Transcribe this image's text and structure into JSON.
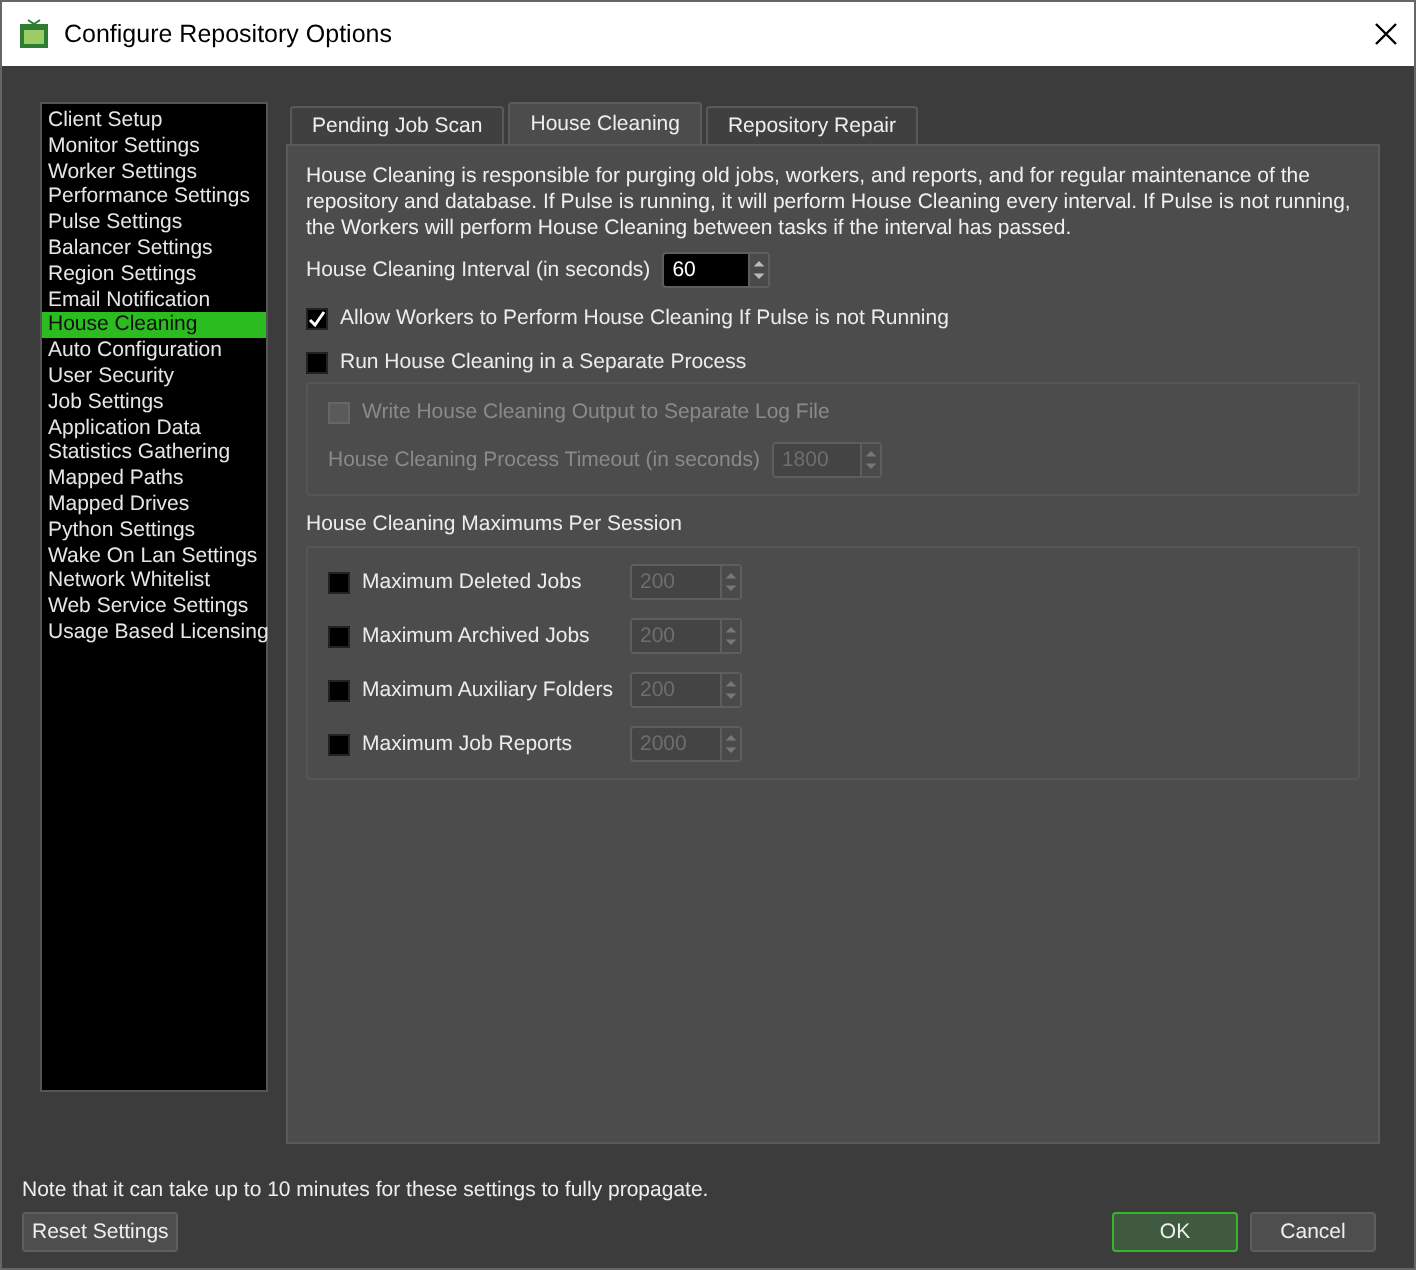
{
  "window": {
    "title": "Configure Repository Options"
  },
  "sidebar": {
    "items": [
      {
        "label": "Client Setup",
        "selected": false
      },
      {
        "label": "Monitor Settings",
        "selected": false
      },
      {
        "label": "Worker Settings",
        "selected": false
      },
      {
        "label": "Performance Settings",
        "selected": false
      },
      {
        "label": "Pulse Settings",
        "selected": false
      },
      {
        "label": "Balancer Settings",
        "selected": false
      },
      {
        "label": "Region Settings",
        "selected": false
      },
      {
        "label": "Email Notification",
        "selected": false
      },
      {
        "label": "House Cleaning",
        "selected": true
      },
      {
        "label": "Auto Configuration",
        "selected": false
      },
      {
        "label": "User Security",
        "selected": false
      },
      {
        "label": "Job Settings",
        "selected": false
      },
      {
        "label": "Application Data",
        "selected": false
      },
      {
        "label": "Statistics Gathering",
        "selected": false
      },
      {
        "label": "Mapped Paths",
        "selected": false
      },
      {
        "label": "Mapped Drives",
        "selected": false
      },
      {
        "label": "Python Settings",
        "selected": false
      },
      {
        "label": "Wake On Lan Settings",
        "selected": false
      },
      {
        "label": "Network Whitelist",
        "selected": false
      },
      {
        "label": "Web Service Settings",
        "selected": false
      },
      {
        "label": "Usage Based Licensing",
        "selected": false
      }
    ]
  },
  "tabs": [
    {
      "label": "Pending Job Scan",
      "selected": false
    },
    {
      "label": "House Cleaning",
      "selected": true
    },
    {
      "label": "Repository Repair",
      "selected": false
    }
  ],
  "description": "House Cleaning is responsible for purging old jobs, workers, and reports, and for regular maintenance of the repository and database. If Pulse is running, it will perform House Cleaning every interval. If Pulse is not running, the Workers will perform House Cleaning between tasks if the interval has passed.",
  "interval": {
    "label": "House Cleaning Interval (in seconds)",
    "value": "60"
  },
  "allow_workers": {
    "label": "Allow Workers to Perform House Cleaning If Pulse is not Running",
    "checked": true
  },
  "separate_process": {
    "label": "Run House Cleaning in a Separate Process",
    "checked": false
  },
  "process_group": {
    "disabled": true,
    "log_file": {
      "label": "Write House Cleaning Output to Separate Log File",
      "checked": false
    },
    "timeout": {
      "label": "House Cleaning Process Timeout (in seconds)",
      "value": "1800"
    }
  },
  "maximums": {
    "title": "House Cleaning Maximums Per Session",
    "rows": [
      {
        "label": "Maximum Deleted Jobs",
        "checked": false,
        "value": "200"
      },
      {
        "label": "Maximum Archived Jobs",
        "checked": false,
        "value": "200"
      },
      {
        "label": "Maximum Auxiliary Folders",
        "checked": false,
        "value": "200"
      },
      {
        "label": "Maximum Job Reports",
        "checked": false,
        "value": "2000"
      }
    ]
  },
  "footer": {
    "note": "Note that it can take up to 10 minutes for these settings to fully propagate.",
    "reset": "Reset Settings",
    "ok": "OK",
    "cancel": "Cancel"
  }
}
